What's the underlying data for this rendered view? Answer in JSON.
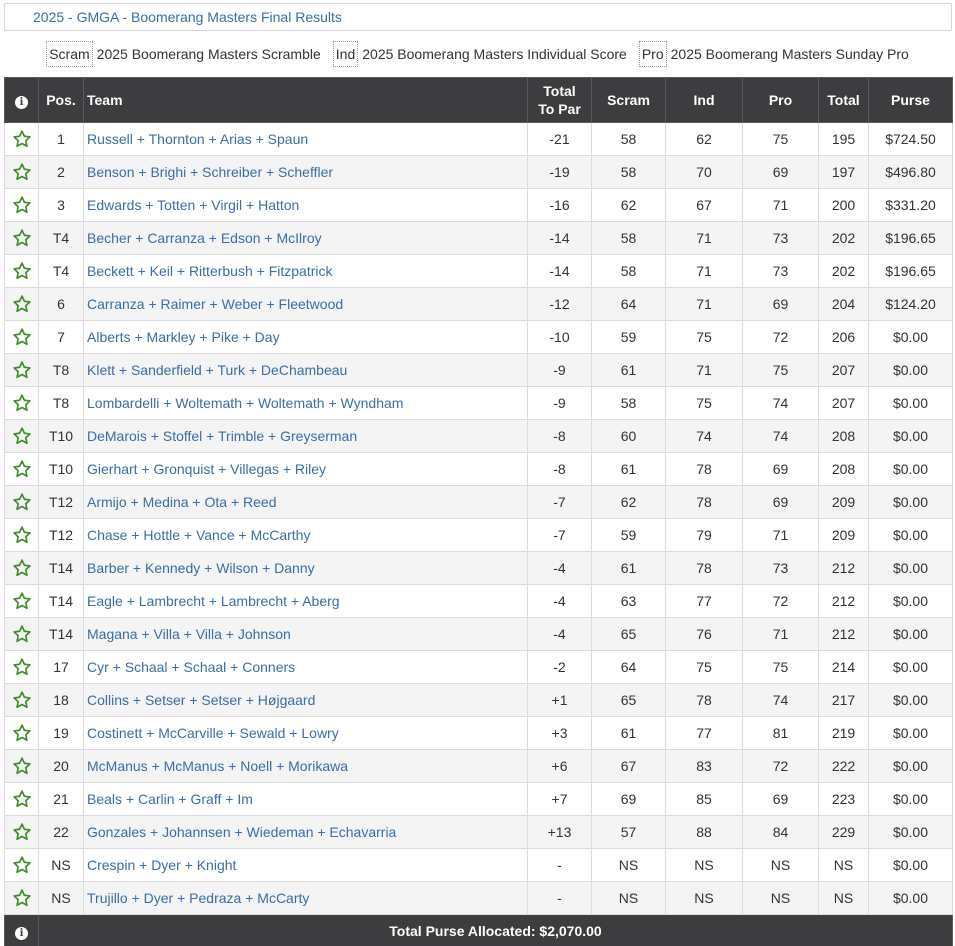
{
  "title": "2025 - GMGA - Boomerang Masters Final Results",
  "legend": [
    {
      "key": "Scram",
      "label": "2025 Boomerang Masters Scramble"
    },
    {
      "key": "Ind",
      "label": "2025 Boomerang Masters Individual Score"
    },
    {
      "key": "Pro",
      "label": "2025 Boomerang Masters Sunday Pro"
    }
  ],
  "columns": {
    "info": "i",
    "pos": "Pos.",
    "team": "Team",
    "total_to_par_line1": "Total",
    "total_to_par_line2": "To Par",
    "scram": "Scram",
    "ind": "Ind",
    "pro": "Pro",
    "total": "Total",
    "purse": "Purse"
  },
  "rows": [
    {
      "pos": "1",
      "team": "Russell + Thornton + Arias + Spaun",
      "to_par": "-21",
      "scram": "58",
      "ind": "62",
      "pro": "75",
      "total": "195",
      "purse": "$724.50"
    },
    {
      "pos": "2",
      "team": "Benson + Brighi + Schreiber + Scheffler",
      "to_par": "-19",
      "scram": "58",
      "ind": "70",
      "pro": "69",
      "total": "197",
      "purse": "$496.80"
    },
    {
      "pos": "3",
      "team": "Edwards + Totten + Virgil + Hatton",
      "to_par": "-16",
      "scram": "62",
      "ind": "67",
      "pro": "71",
      "total": "200",
      "purse": "$331.20"
    },
    {
      "pos": "T4",
      "team": "Becher + Carranza + Edson + McIlroy",
      "to_par": "-14",
      "scram": "58",
      "ind": "71",
      "pro": "73",
      "total": "202",
      "purse": "$196.65"
    },
    {
      "pos": "T4",
      "team": "Beckett + Keil + Ritterbush + Fitzpatrick",
      "to_par": "-14",
      "scram": "58",
      "ind": "71",
      "pro": "73",
      "total": "202",
      "purse": "$196.65"
    },
    {
      "pos": "6",
      "team": "Carranza + Raimer + Weber + Fleetwood",
      "to_par": "-12",
      "scram": "64",
      "ind": "71",
      "pro": "69",
      "total": "204",
      "purse": "$124.20"
    },
    {
      "pos": "7",
      "team": "Alberts + Markley + Pike + Day",
      "to_par": "-10",
      "scram": "59",
      "ind": "75",
      "pro": "72",
      "total": "206",
      "purse": "$0.00"
    },
    {
      "pos": "T8",
      "team": "Klett + Sanderfield + Turk + DeChambeau",
      "to_par": "-9",
      "scram": "61",
      "ind": "71",
      "pro": "75",
      "total": "207",
      "purse": "$0.00"
    },
    {
      "pos": "T8",
      "team": "Lombardelli + Woltemath + Woltemath + Wyndham",
      "to_par": "-9",
      "scram": "58",
      "ind": "75",
      "pro": "74",
      "total": "207",
      "purse": "$0.00"
    },
    {
      "pos": "T10",
      "team": "DeMarois + Stoffel + Trimble + Greyserman",
      "to_par": "-8",
      "scram": "60",
      "ind": "74",
      "pro": "74",
      "total": "208",
      "purse": "$0.00"
    },
    {
      "pos": "T10",
      "team": "Gierhart + Gronquist + Villegas + Riley",
      "to_par": "-8",
      "scram": "61",
      "ind": "78",
      "pro": "69",
      "total": "208",
      "purse": "$0.00"
    },
    {
      "pos": "T12",
      "team": "Armijo + Medina + Ota + Reed",
      "to_par": "-7",
      "scram": "62",
      "ind": "78",
      "pro": "69",
      "total": "209",
      "purse": "$0.00"
    },
    {
      "pos": "T12",
      "team": "Chase + Hottle + Vance + McCarthy",
      "to_par": "-7",
      "scram": "59",
      "ind": "79",
      "pro": "71",
      "total": "209",
      "purse": "$0.00"
    },
    {
      "pos": "T14",
      "team": "Barber + Kennedy + Wilson + Danny",
      "to_par": "-4",
      "scram": "61",
      "ind": "78",
      "pro": "73",
      "total": "212",
      "purse": "$0.00"
    },
    {
      "pos": "T14",
      "team": "Eagle + Lambrecht + Lambrecht + Aberg",
      "to_par": "-4",
      "scram": "63",
      "ind": "77",
      "pro": "72",
      "total": "212",
      "purse": "$0.00"
    },
    {
      "pos": "T14",
      "team": "Magana + Villa + Villa + Johnson",
      "to_par": "-4",
      "scram": "65",
      "ind": "76",
      "pro": "71",
      "total": "212",
      "purse": "$0.00"
    },
    {
      "pos": "17",
      "team": "Cyr + Schaal + Schaal + Conners",
      "to_par": "-2",
      "scram": "64",
      "ind": "75",
      "pro": "75",
      "total": "214",
      "purse": "$0.00"
    },
    {
      "pos": "18",
      "team": "Collins + Setser + Setser + Højgaard",
      "to_par": "+1",
      "scram": "65",
      "ind": "78",
      "pro": "74",
      "total": "217",
      "purse": "$0.00"
    },
    {
      "pos": "19",
      "team": "Costinett + McCarville + Sewald + Lowry",
      "to_par": "+3",
      "scram": "61",
      "ind": "77",
      "pro": "81",
      "total": "219",
      "purse": "$0.00"
    },
    {
      "pos": "20",
      "team": "McManus + McManus + Noell + Morikawa",
      "to_par": "+6",
      "scram": "67",
      "ind": "83",
      "pro": "72",
      "total": "222",
      "purse": "$0.00"
    },
    {
      "pos": "21",
      "team": "Beals + Carlin + Graff + Im",
      "to_par": "+7",
      "scram": "69",
      "ind": "85",
      "pro": "69",
      "total": "223",
      "purse": "$0.00"
    },
    {
      "pos": "22",
      "team": "Gonzales + Johannsen + Wiedeman + Echavarria",
      "to_par": "+13",
      "scram": "57",
      "ind": "88",
      "pro": "84",
      "total": "229",
      "purse": "$0.00"
    },
    {
      "pos": "NS",
      "team": "Crespin + Dyer + Knight",
      "to_par": "-",
      "scram": "NS",
      "ind": "NS",
      "pro": "NS",
      "total": "NS",
      "purse": "$0.00"
    },
    {
      "pos": "NS",
      "team": "Trujillo + Dyer + Pedraza + McCarty",
      "to_par": "-",
      "scram": "NS",
      "ind": "NS",
      "pro": "NS",
      "total": "NS",
      "purse": "$0.00"
    }
  ],
  "footer": {
    "info": "i",
    "total_purse": "Total Purse Allocated: $2,070.00"
  },
  "icons": {
    "star": "star-outline-icon",
    "info": "info-circle-icon"
  },
  "colors": {
    "header_bg": "#3d3d40",
    "link": "#3a6ea5",
    "star": "#3e8e2c"
  }
}
